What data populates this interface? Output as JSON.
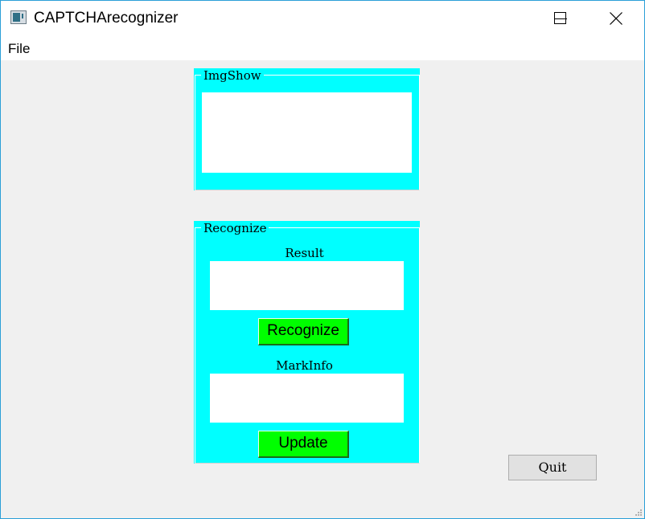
{
  "window": {
    "title": "CAPTCHArecognizer",
    "icons": {
      "app": "app-window-icon",
      "minimize": "minimize-icon",
      "maximize": "maximize-icon",
      "close": "close-icon"
    }
  },
  "menubar": {
    "items": [
      {
        "label": "File"
      }
    ]
  },
  "imgshow": {
    "group_label": "ImgShow"
  },
  "recognize": {
    "group_label": "Recognize",
    "result_label": "Result",
    "result_value": "",
    "recognize_button": "Recognize",
    "markinfo_label": "MarkInfo",
    "markinfo_value": "",
    "update_button": "Update"
  },
  "quit_button": "Quit",
  "colors": {
    "groupbox_bg": "#00ffff",
    "action_button_bg": "#00ff00",
    "window_bg": "#f0f0f0",
    "window_border": "#2b9fd8"
  }
}
